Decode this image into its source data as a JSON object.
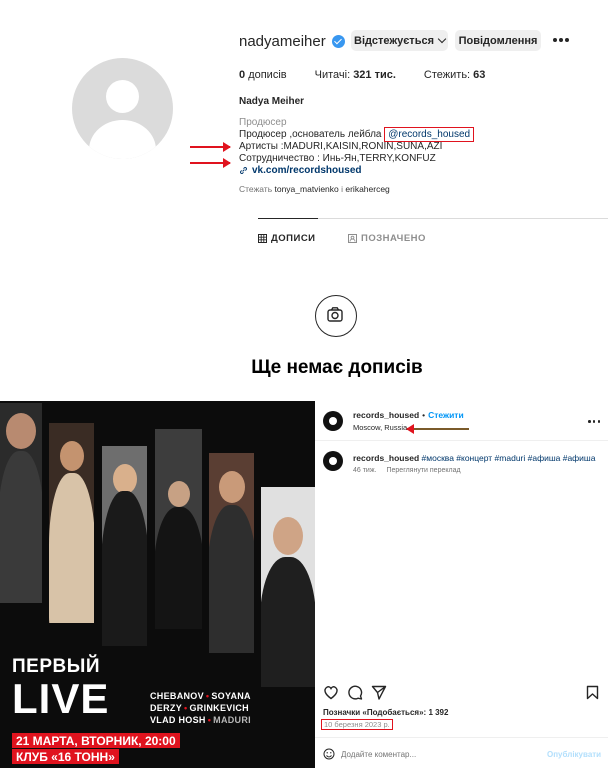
{
  "profile": {
    "username": "nadyameiher",
    "follow_button": "Відстежується",
    "message_button": "Повідомлення",
    "stats": {
      "posts_value": "0",
      "posts_label": "дописів",
      "followers_label": "Читачі:",
      "followers_value": "321 тис.",
      "following_label": "Стежить:",
      "following_value": "63"
    },
    "full_name": "Nadya Meiher",
    "category": "Продюсер",
    "bio_line1_prefix": "Продюсер ,основатель лейбла ",
    "bio_mention": "@records_housed",
    "bio_line2": "Артисты :MADURI,KAISIN,RONIN,SUNA,AZI",
    "bio_line3": "Сотрудничество : Инь-Ян,TERRY,KONFUZ",
    "link": "vk.com/recordshoused",
    "followed_by_prefix": "Стежать ",
    "followed_by_names": "tonya_matvienko",
    "followed_by_sep": " і ",
    "followed_by_names2": "erikaherceg",
    "tabs": {
      "posts": "ДОПИСИ",
      "tagged": "ПОЗНАЧЕНО"
    },
    "empty_title": "Ще немає дописів"
  },
  "post": {
    "poster": {
      "headline_small": "ПЕРВЫЙ",
      "headline_big": "LIVE",
      "artists_row1_a": "CHEBANOV",
      "artists_row1_b": "SOYANA",
      "artists_row2_a": "DERZY",
      "artists_row2_b": "GRINKEVICH",
      "artists_row3_a": "VLAD HOSH",
      "artists_row3_b": "MADURI",
      "date_line": "21 МАРТА, ВТОРНИК, 20:00",
      "venue_line": "КЛУБ «16 ТОНН»"
    },
    "account": "records_housed",
    "separator": "•",
    "follow_link": "Стежити",
    "location": "Moscow, Russia",
    "caption_account": "records_housed",
    "caption_tags": "#москва #концерт #maduri #афиша #афиша",
    "age": "46 тиж.",
    "translate": "Переглянути переклад",
    "likes_prefix": "Позначки «Подобається»:",
    "likes_value": "1 392",
    "date": "10 березня 2023 р.",
    "comment_placeholder": "Додайте коментар...",
    "publish": "Опублікувати"
  },
  "colors": {
    "annotation_red": "#e0131e",
    "verified_blue": "#3897f0",
    "link_blue": "#00376b",
    "follow_blue": "#0095f6"
  }
}
